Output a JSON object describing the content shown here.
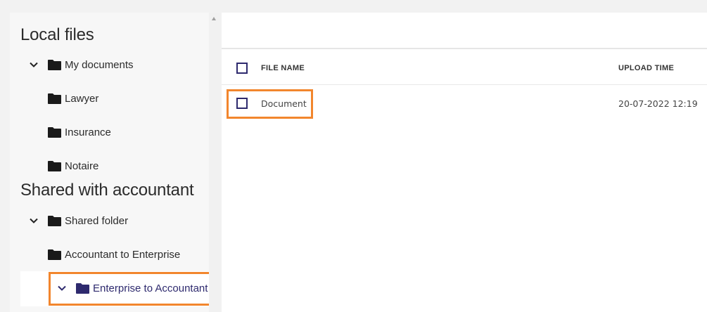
{
  "sidebar": {
    "sections": [
      {
        "title": "Local files",
        "items": [
          {
            "label": "My documents",
            "expanded": true
          },
          {
            "label": "Lawyer"
          },
          {
            "label": "Insurance"
          },
          {
            "label": "Notaire"
          }
        ]
      },
      {
        "title": "Shared with accountant",
        "items": [
          {
            "label": "Shared folder",
            "expanded": true
          },
          {
            "label": "Accountant to Enterprise"
          },
          {
            "label": "Enterprise to Accountant",
            "expanded": true,
            "selected": true
          }
        ]
      }
    ]
  },
  "table": {
    "headers": {
      "file_name": "FILE NAME",
      "upload_time": "UPLOAD TIME"
    },
    "rows": [
      {
        "file_name": "Document",
        "upload_time": "20-07-2022 12:19"
      }
    ]
  },
  "colors": {
    "accent": "#2e2a6e",
    "highlight": "#f2862d",
    "folder": "#1a1a1a"
  }
}
